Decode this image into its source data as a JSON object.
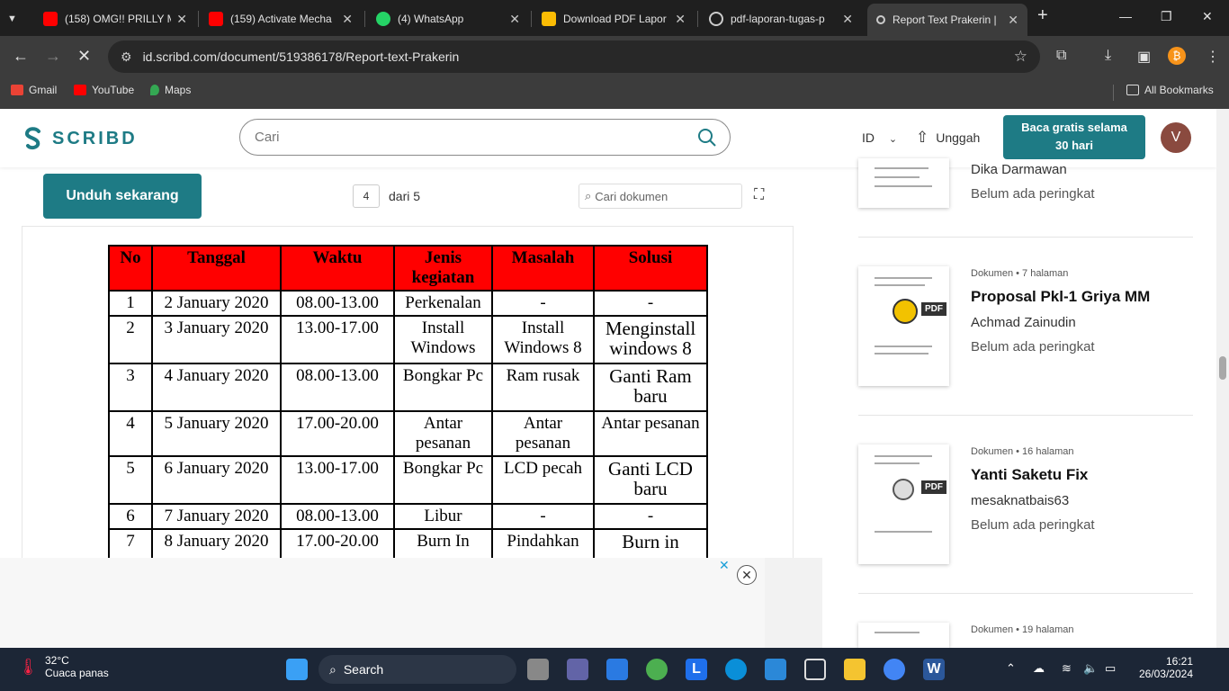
{
  "tabs": [
    {
      "title": "(158) OMG!! PRILLY M",
      "favicon": "youtube-icon"
    },
    {
      "title": "(159) Activate Mecha",
      "favicon": "youtube-icon"
    },
    {
      "title": "(4) WhatsApp",
      "favicon": "whatsapp-icon"
    },
    {
      "title": "Download PDF Lapor",
      "favicon": "doc-icon"
    },
    {
      "title": "pdf-laporan-tugas-p",
      "favicon": "globe-icon"
    },
    {
      "title": "Report Text Prakerin |",
      "favicon": "scribd-icon",
      "active": true
    }
  ],
  "address": {
    "url": "id.scribd.com/document/519386178/Report-text-Prakerin"
  },
  "bookmarks": [
    {
      "label": "Gmail",
      "color": "#ea4335"
    },
    {
      "label": "YouTube",
      "color": "#ff0000"
    },
    {
      "label": "Maps",
      "color": "#34a853"
    }
  ],
  "bookmarks_all": "All Bookmarks",
  "scribd": {
    "logo": "SCRIBD",
    "search_placeholder": "Cari",
    "lang": "ID",
    "upload": "Unggah",
    "cta_line1": "Baca gratis selama",
    "cta_line2": "30 hari",
    "avatar": "V",
    "accent": "#1e7b85"
  },
  "doc": {
    "download": "Unduh sekarang",
    "page_current": "4",
    "page_of": "dari 5",
    "search_placeholder": "Cari dokumen"
  },
  "table": {
    "headers": [
      "No",
      "Tanggal",
      "Waktu",
      "Jenis kegiatan",
      "Masalah",
      "Solusi"
    ],
    "rows": [
      [
        "1",
        "2 January 2020",
        "08.00-13.00",
        "Perkenalan",
        "-",
        "-"
      ],
      [
        "2",
        "3 January 2020",
        "13.00-17.00",
        "Install Windows",
        "Install Windows 8",
        "Menginstall windows 8"
      ],
      [
        "3",
        "4 January 2020",
        "08.00-13.00",
        "Bongkar Pc",
        "Ram rusak",
        "Ganti Ram baru"
      ],
      [
        "4",
        "5 January 2020",
        "17.00-20.00",
        "Antar pesanan",
        "Antar pesanan",
        "Antar pesanan"
      ],
      [
        "5",
        "6 January 2020",
        "13.00-17.00",
        "Bongkar Pc",
        "LCD pecah",
        "Ganti LCD baru"
      ],
      [
        "6",
        "7 January 2020",
        "08.00-13.00",
        "Libur",
        "-",
        "-"
      ],
      [
        "7",
        "8 January 2020",
        "17.00-20.00",
        "Burn In",
        "Pindahkan",
        "Burn in"
      ]
    ]
  },
  "sidebar": {
    "cards": [
      {
        "meta": "",
        "title": "",
        "author": "Dika Darmawan",
        "rating": "Belum ada peringkat"
      },
      {
        "meta": "Dokumen • 7 halaman",
        "title": "Proposal Pkl-1 Griya MM",
        "author": "Achmad Zainudin",
        "rating": "Belum ada peringkat",
        "badge": "PDF"
      },
      {
        "meta": "Dokumen • 16 halaman",
        "title": "Yanti Saketu Fix",
        "author": "mesaknatbais63",
        "rating": "Belum ada peringkat",
        "badge": "PDF"
      },
      {
        "meta": "Dokumen • 19 halaman",
        "title": "",
        "author": "",
        "rating": ""
      }
    ]
  },
  "taskbar": {
    "temp": "32°C",
    "weather": "Cuaca panas",
    "search": "Search",
    "time": "16:21",
    "date": "26/03/2024"
  }
}
